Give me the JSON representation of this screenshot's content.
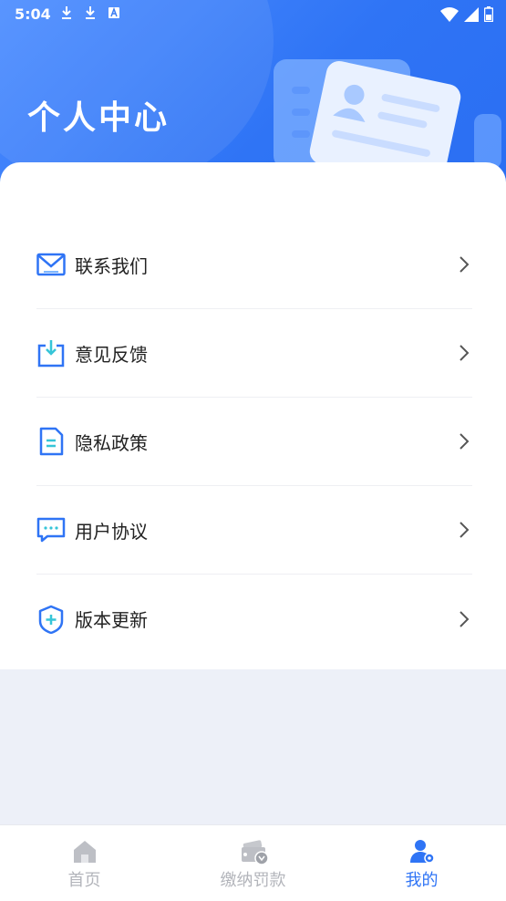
{
  "status_bar": {
    "time": "5:04",
    "left_icons": [
      "download-icon",
      "download-icon",
      "text-app-icon"
    ],
    "right_icons": [
      "wifi-icon",
      "signal-icon",
      "battery-icon"
    ]
  },
  "header": {
    "title": "个人中心",
    "gradient_colors": [
      "#4b8cff",
      "#2f74f5"
    ]
  },
  "menu": {
    "items": [
      {
        "label": "联系我们",
        "icon": "mail-icon"
      },
      {
        "label": "意见反馈",
        "icon": "feedback-icon"
      },
      {
        "label": "隐私政策",
        "icon": "document-icon"
      },
      {
        "label": "用户协议",
        "icon": "chat-icon"
      },
      {
        "label": "版本更新",
        "icon": "shield-plus-icon"
      }
    ]
  },
  "tabbar": {
    "tabs": [
      {
        "label": "首页",
        "icon": "home-icon",
        "active": false
      },
      {
        "label": "缴纳罚款",
        "icon": "ticket-icon",
        "active": false
      },
      {
        "label": "我的",
        "icon": "user-settings-icon",
        "active": true
      }
    ]
  },
  "colors": {
    "accent": "#2f74f5",
    "inactive": "#b3b5bb",
    "page_bg": "#edf0f8"
  }
}
